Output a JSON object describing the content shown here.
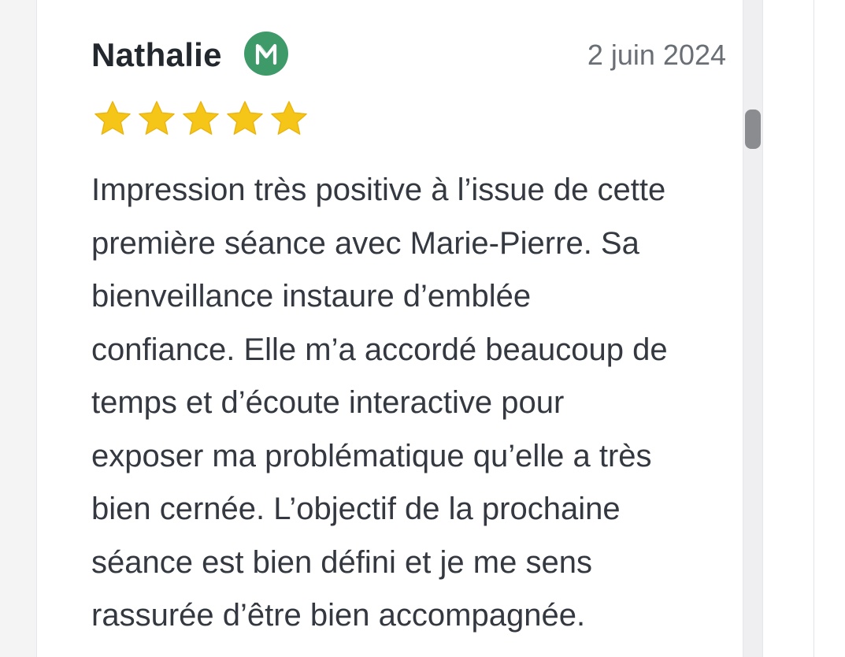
{
  "review": {
    "author": "Nathalie",
    "badge_icon": "verified-m-badge-icon",
    "badge_color": "#3f9a6a",
    "date": "2 juin 2024",
    "rating": 5,
    "rating_max": 5,
    "star_color": "#f5c518",
    "star_icon": "star-icon",
    "text": "Impression très positive à l’issue de cette\npremière séance avec Marie-Pierre. Sa\nbienveillance instaure d’emblée\nconfiance. Elle m’a accordé beaucoup de\ntemps et d’écoute interactive pour\nexposer ma problématique qu’elle a très\nbien cernée. L’objectif de la prochaine\nséance est bien défini et je me sens\nrassurée d’être bien accompagnée."
  },
  "scrollbar": {
    "position": 0.17
  }
}
